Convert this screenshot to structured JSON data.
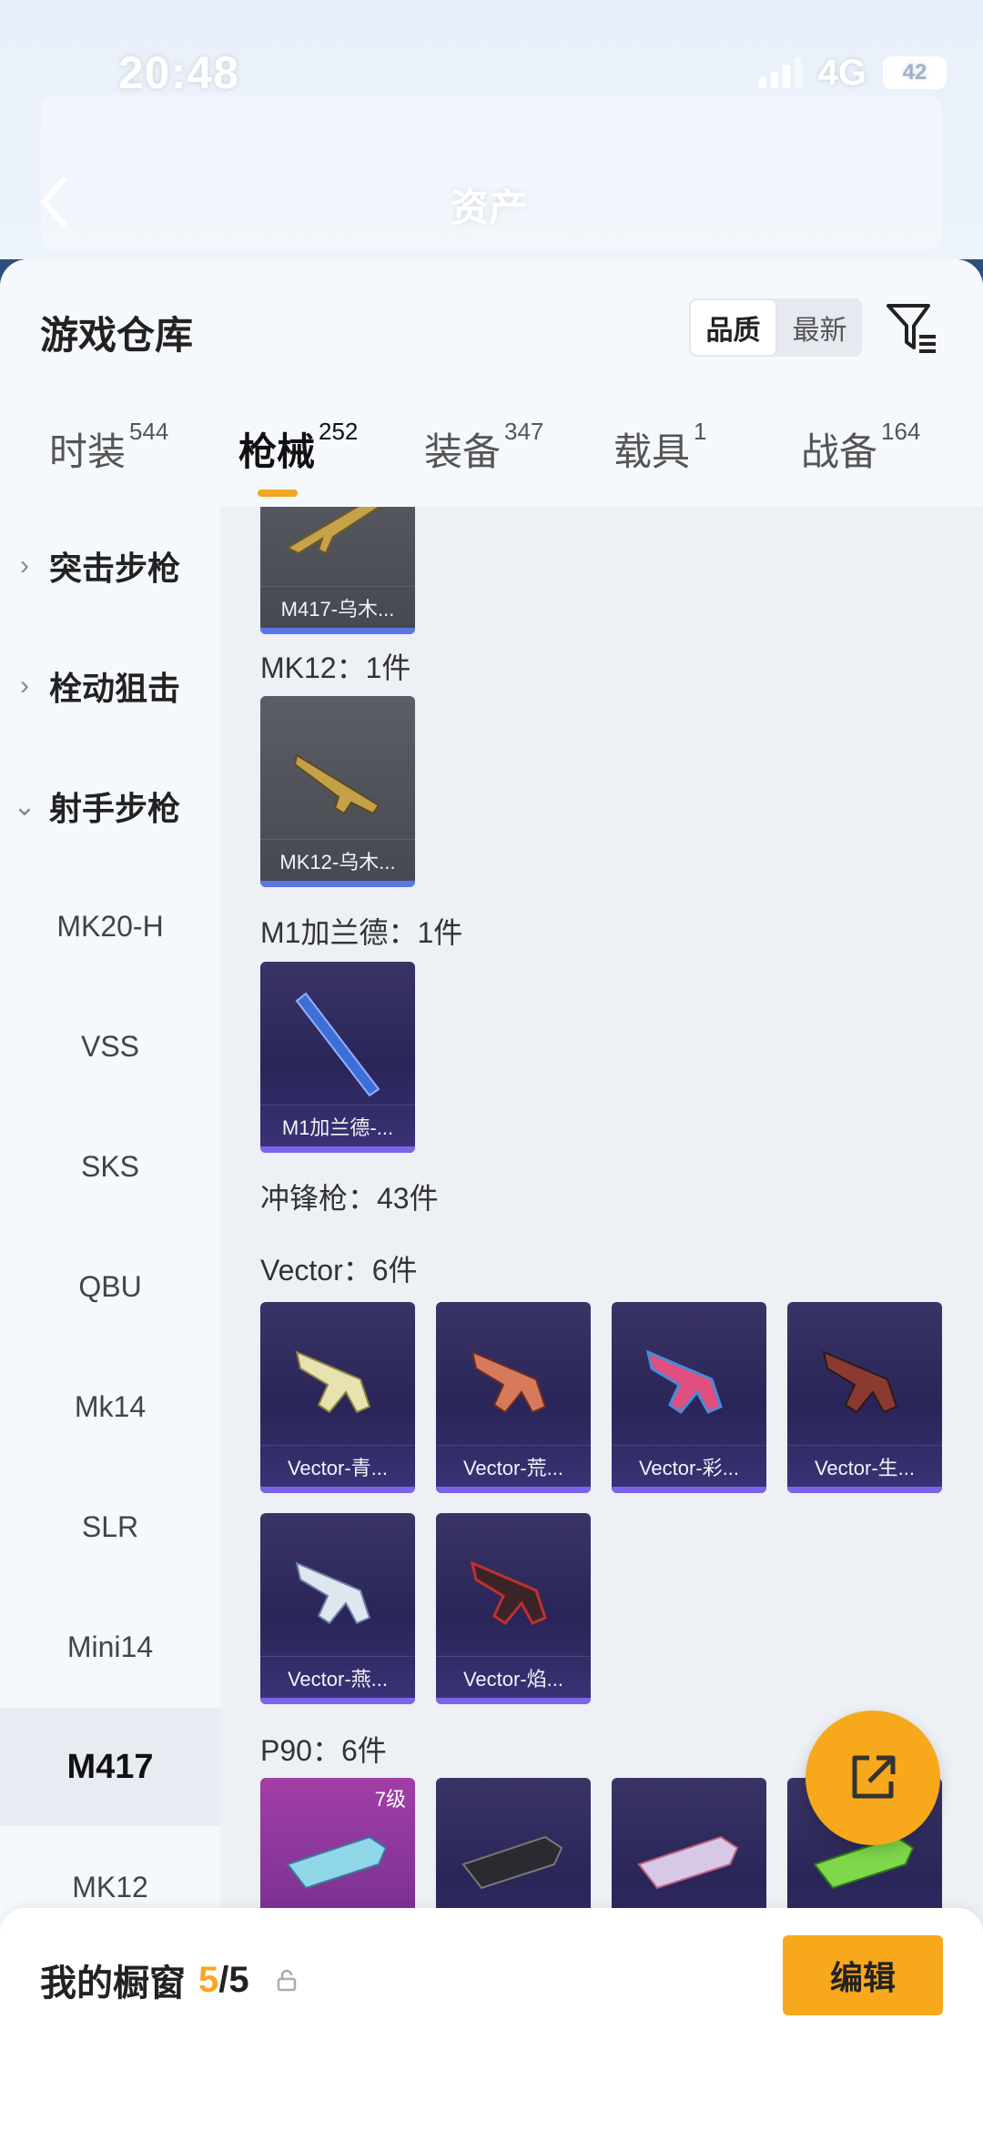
{
  "status_bar": {
    "time": "20:48",
    "network": "4G",
    "battery": "42"
  },
  "header": {
    "assets_title": "资产"
  },
  "sheet": {
    "title": "游戏仓库",
    "sort": {
      "options": [
        "品质",
        "最新"
      ],
      "selected": "品质"
    },
    "tabs": [
      {
        "label": "时装",
        "count": "544"
      },
      {
        "label": "枪械",
        "count": "252",
        "active": true
      },
      {
        "label": "装备",
        "count": "347"
      },
      {
        "label": "载具",
        "count": "1"
      },
      {
        "label": "战备",
        "count": "164"
      }
    ]
  },
  "side_nav": {
    "categories": [
      {
        "label": "突击步枪",
        "expanded": false
      },
      {
        "label": "栓动狙击",
        "expanded": false
      },
      {
        "label": "射手步枪",
        "expanded": true
      }
    ],
    "items": [
      "MK20-H",
      "VSS",
      "SKS",
      "QBU",
      "Mk14",
      "SLR",
      "Mini14",
      "M417",
      "MK12"
    ],
    "active_item": "M417"
  },
  "content": {
    "sections": [
      {
        "label": "MK12：1件",
        "items": [
          {
            "name": "MK12-乌木..."
          }
        ]
      },
      {
        "label": "M1加兰德：1件",
        "items": [
          {
            "name": "M1加兰德-..."
          }
        ]
      },
      {
        "label": "冲锋枪：43件"
      },
      {
        "label": "Vector：6件",
        "items": [
          {
            "name": "Vector-青..."
          },
          {
            "name": "Vector-荒..."
          },
          {
            "name": "Vector-彩..."
          },
          {
            "name": "Vector-生..."
          },
          {
            "name": "Vector-燕..."
          },
          {
            "name": "Vector-焰..."
          }
        ]
      },
      {
        "label": "P90：6件",
        "items": [
          {
            "level": "7级"
          }
        ]
      }
    ],
    "top_partial_item": "M417-乌木..."
  },
  "bottom_bar": {
    "label": "我的橱窗",
    "count": "5",
    "total": "/5",
    "edit": "编辑"
  },
  "colors": {
    "accent": "#f7a81b",
    "rare_bar": "#7b63ea",
    "common_bar": "#5b76e6"
  }
}
